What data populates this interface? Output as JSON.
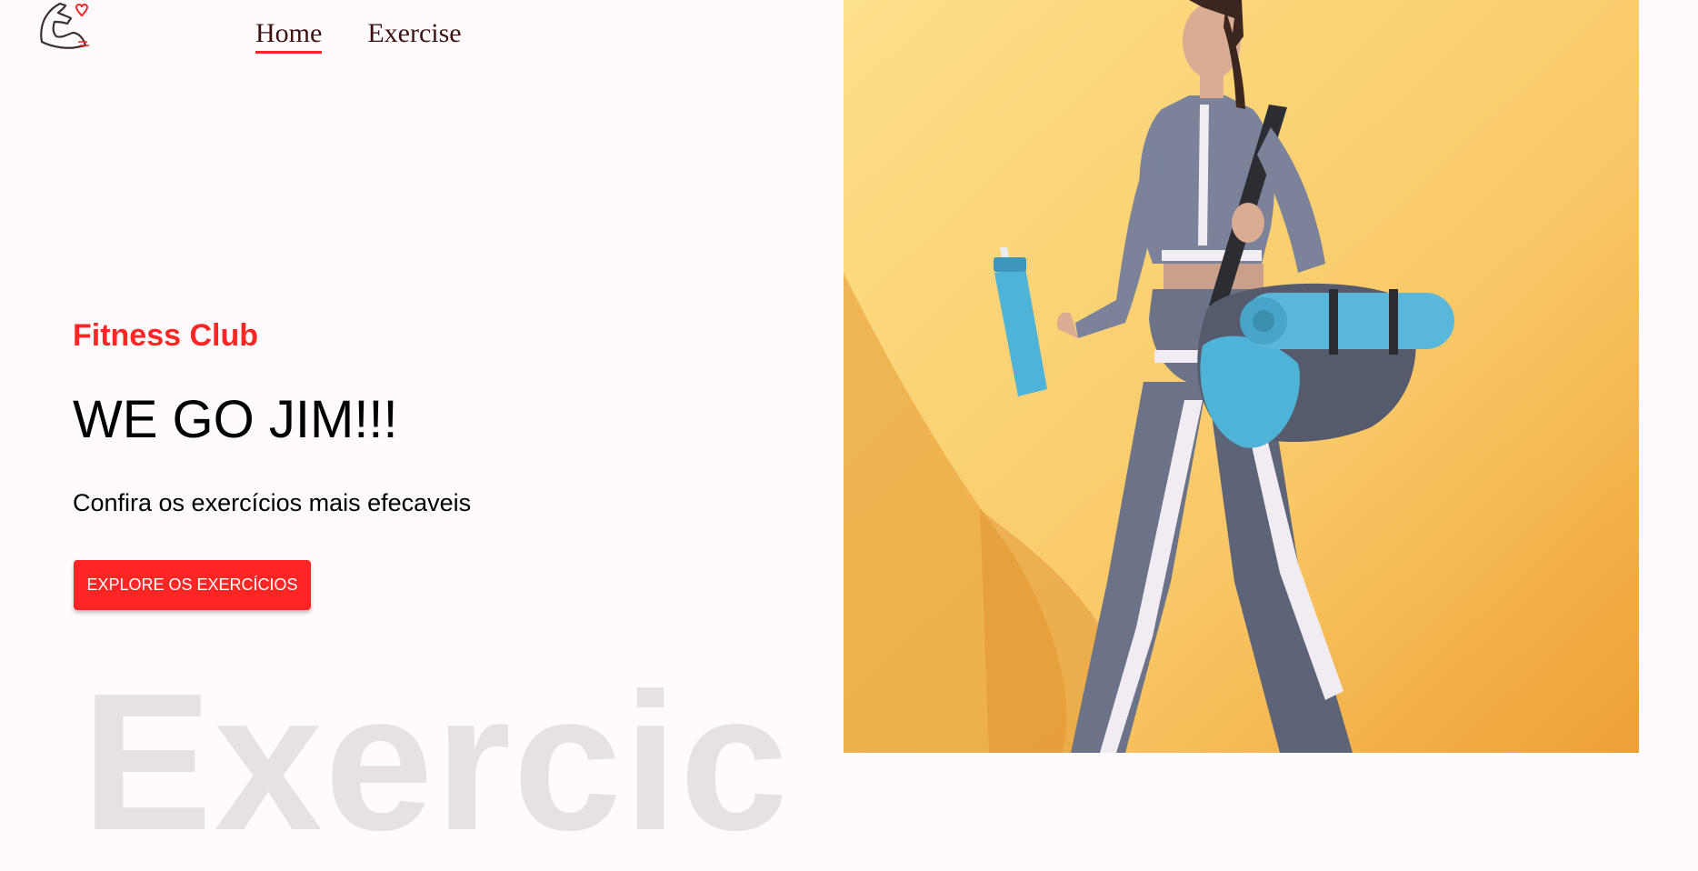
{
  "nav": {
    "items": [
      {
        "label": "Home",
        "active": true
      },
      {
        "label": "Exercise",
        "active": false
      }
    ]
  },
  "hero": {
    "tagline": "Fitness Club",
    "headline": "WE GO JIM!!!",
    "subtitle": "Confira os exercícios mais efecaveis",
    "cta_label": "EXPLORE OS EXERCÍCIOS",
    "background_word": "Exercic"
  },
  "icons": {
    "logo": "flexed-arm-with-heart-icon"
  },
  "colors": {
    "accent": "#ff2625",
    "page_background": "#fffafb",
    "hero_image_background": "#f7c56a",
    "background_word": "#e6e2e3"
  }
}
